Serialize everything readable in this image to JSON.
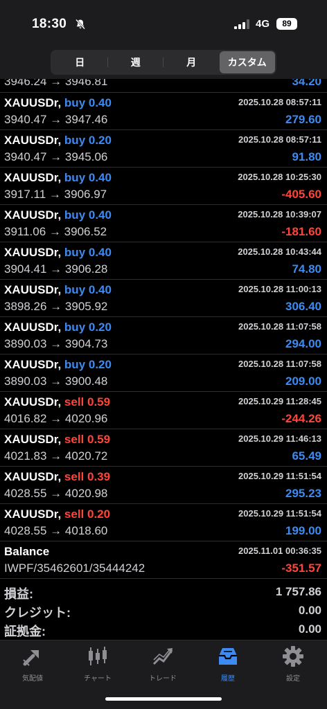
{
  "status": {
    "time": "18:30",
    "network": "4G",
    "battery": "89"
  },
  "segments": [
    "日",
    "週",
    "月",
    "カスタム"
  ],
  "partial_row": {
    "prices": "3946.24 → 3946.81",
    "pl": "34.20"
  },
  "trades": [
    {
      "symbol": "XAUUSDr,",
      "side": "buy 0.40",
      "type": "buy",
      "datetime": "2025.10.28 08:57:11",
      "open": "3940.47",
      "close": "3947.46",
      "pl": "279.60",
      "sign": "pos"
    },
    {
      "symbol": "XAUUSDr,",
      "side": "buy 0.20",
      "type": "buy",
      "datetime": "2025.10.28 08:57:11",
      "open": "3940.47",
      "close": "3945.06",
      "pl": "91.80",
      "sign": "pos"
    },
    {
      "symbol": "XAUUSDr,",
      "side": "buy 0.40",
      "type": "buy",
      "datetime": "2025.10.28 10:25:30",
      "open": "3917.11",
      "close": "3906.97",
      "pl": "-405.60",
      "sign": "neg"
    },
    {
      "symbol": "XAUUSDr,",
      "side": "buy 0.40",
      "type": "buy",
      "datetime": "2025.10.28 10:39:07",
      "open": "3911.06",
      "close": "3906.52",
      "pl": "-181.60",
      "sign": "neg"
    },
    {
      "symbol": "XAUUSDr,",
      "side": "buy 0.40",
      "type": "buy",
      "datetime": "2025.10.28 10:43:44",
      "open": "3904.41",
      "close": "3906.28",
      "pl": "74.80",
      "sign": "pos"
    },
    {
      "symbol": "XAUUSDr,",
      "side": "buy 0.40",
      "type": "buy",
      "datetime": "2025.10.28 11:00:13",
      "open": "3898.26",
      "close": "3905.92",
      "pl": "306.40",
      "sign": "pos"
    },
    {
      "symbol": "XAUUSDr,",
      "side": "buy 0.20",
      "type": "buy",
      "datetime": "2025.10.28 11:07:58",
      "open": "3890.03",
      "close": "3904.73",
      "pl": "294.00",
      "sign": "pos"
    },
    {
      "symbol": "XAUUSDr,",
      "side": "buy 0.20",
      "type": "buy",
      "datetime": "2025.10.28 11:07:58",
      "open": "3890.03",
      "close": "3900.48",
      "pl": "209.00",
      "sign": "pos"
    },
    {
      "symbol": "XAUUSDr,",
      "side": "sell 0.59",
      "type": "sell",
      "datetime": "2025.10.29 11:28:45",
      "open": "4016.82",
      "close": "4020.96",
      "pl": "-244.26",
      "sign": "neg"
    },
    {
      "symbol": "XAUUSDr,",
      "side": "sell 0.59",
      "type": "sell",
      "datetime": "2025.10.29 11:46:13",
      "open": "4021.83",
      "close": "4020.72",
      "pl": "65.49",
      "sign": "pos"
    },
    {
      "symbol": "XAUUSDr,",
      "side": "sell 0.39",
      "type": "sell",
      "datetime": "2025.10.29 11:51:54",
      "open": "4028.55",
      "close": "4020.98",
      "pl": "295.23",
      "sign": "pos"
    },
    {
      "symbol": "XAUUSDr,",
      "side": "sell 0.20",
      "type": "sell",
      "datetime": "2025.10.29 11:51:54",
      "open": "4028.55",
      "close": "4018.60",
      "pl": "199.00",
      "sign": "pos"
    }
  ],
  "balance": {
    "label": "Balance",
    "datetime": "2025.11.01 00:36:35",
    "comment": "IWPF/35462601/35444242",
    "amount": "-351.57"
  },
  "summary": [
    {
      "label": "損益:",
      "value": "1 757.86"
    },
    {
      "label": "クレジット:",
      "value": "0.00"
    },
    {
      "label": "証拠金:",
      "value": "0.00"
    }
  ],
  "tabs": [
    {
      "label": "気配値",
      "icon": "quotes-icon"
    },
    {
      "label": "チャート",
      "icon": "chart-icon"
    },
    {
      "label": "トレード",
      "icon": "trade-icon"
    },
    {
      "label": "履歴",
      "icon": "history-icon",
      "active": true
    },
    {
      "label": "設定",
      "icon": "gear-icon"
    }
  ],
  "colors": {
    "buy": "#3d8bf2",
    "sell": "#ff453a",
    "background": "#000000",
    "bar": "#1c1c1e"
  }
}
